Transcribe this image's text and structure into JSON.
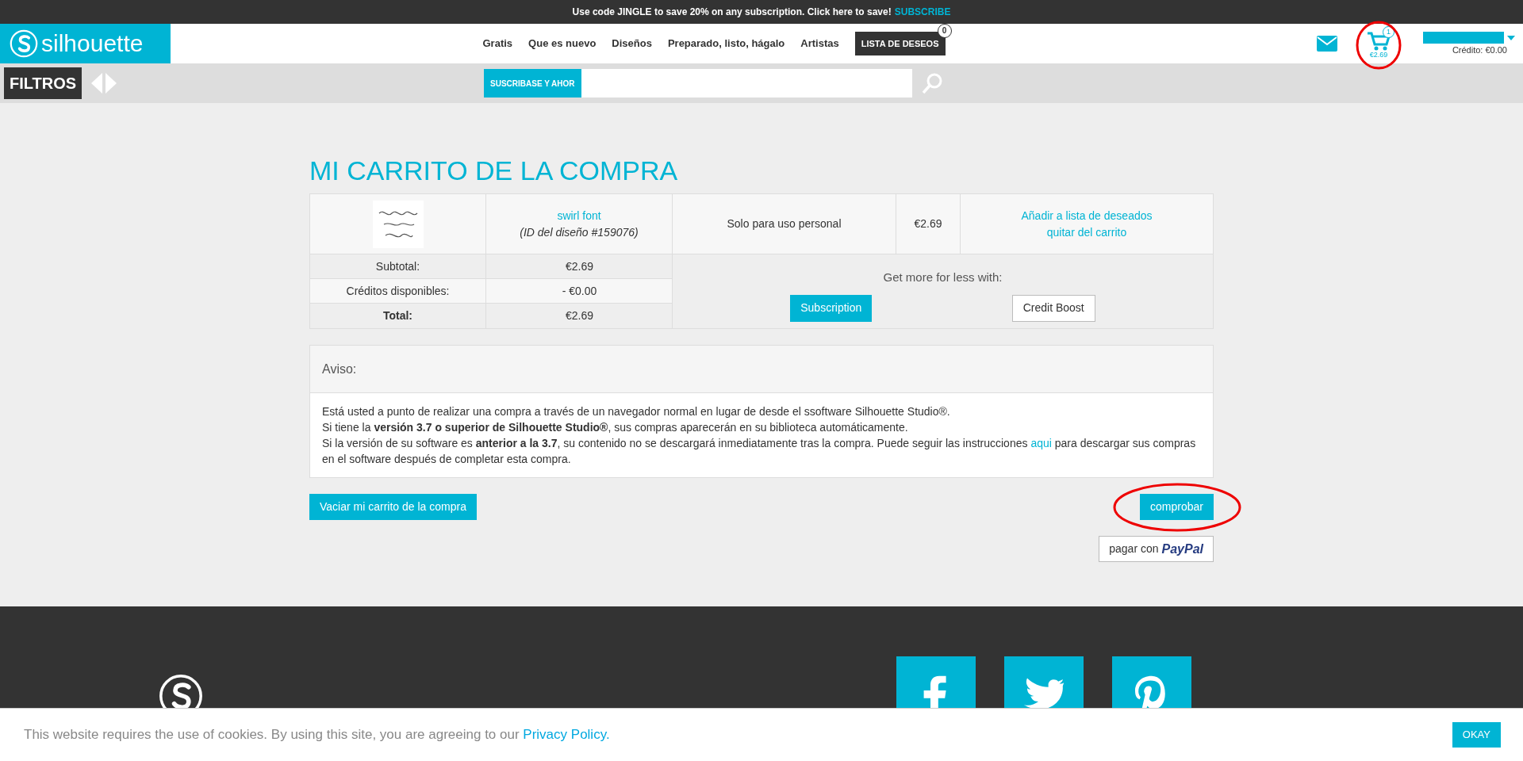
{
  "promo_bar": {
    "text": "Use code JINGLE to save 20% on any subscription. Click here to save!",
    "link": "SUBSCRIBE"
  },
  "header": {
    "logo": "silhouette",
    "nav": [
      "Gratis",
      "Que es nuevo",
      "Diseños",
      "Preparado, listo, hágalo",
      "Artistas"
    ],
    "wishlist": {
      "label": "LISTA DE DESEOS",
      "count": "0"
    },
    "cart": {
      "count": "1",
      "total": "€2.69"
    },
    "account": {
      "credit": "Crédito: €0.00"
    }
  },
  "filter_bar": {
    "label": "FILTROS",
    "search_tag": "SUSCRIBASE Y AHOR"
  },
  "cart": {
    "title": "MI CARRITO DE LA COMPRA",
    "items": [
      {
        "name": "swirl font",
        "design_id": "(ID del diseño #159076)",
        "license": "Solo para uso personal",
        "price": "€2.69",
        "actions": [
          "Añadir a lista de deseados",
          "quitar del carrito"
        ]
      }
    ],
    "summary": [
      {
        "label": "Subtotal:",
        "value": "€2.69",
        "bold": false
      },
      {
        "label": "Créditos disponibles:",
        "value": "- €0.00",
        "bold": false
      },
      {
        "label": "Total:",
        "value": "€2.69",
        "bold": true
      }
    ],
    "upsell": {
      "text": "Get more for less with:",
      "buttons": [
        {
          "label": "Subscription",
          "kind": "primary"
        },
        {
          "label": "Credit Boost",
          "kind": "outline"
        }
      ]
    }
  },
  "notice": {
    "title": "Aviso:",
    "lines": [
      "Está usted a punto de realizar una compra a través de un navegador normal en lugar de desde el ssoftware Silhouette Studio®.",
      "Si tiene la **versión 3.7 o superior de Silhouette Studio®**, sus compras aparecerán en su biblioteca automáticamente."
    ],
    "last_line_before": "Si la versión de su software es **anterior a la 3.7**, su contenido no se descargará inmediatamente tras la compra. Puede seguir las instrucciones ",
    "last_line_link": "aqui",
    "last_line_after": " para descargar sus compras en el software después de completar esta compra."
  },
  "actions": {
    "empty_cart": "Vaciar mi carrito de la compra",
    "checkout": "comprobar",
    "paypal_prefix": "pagar con",
    "paypal_brand": "PayPal"
  },
  "cookie_banner": {
    "text": "This website requires the use of cookies. By using this site, you are agreeing to our ",
    "link": "Privacy Policy.",
    "button": "OKAY"
  }
}
